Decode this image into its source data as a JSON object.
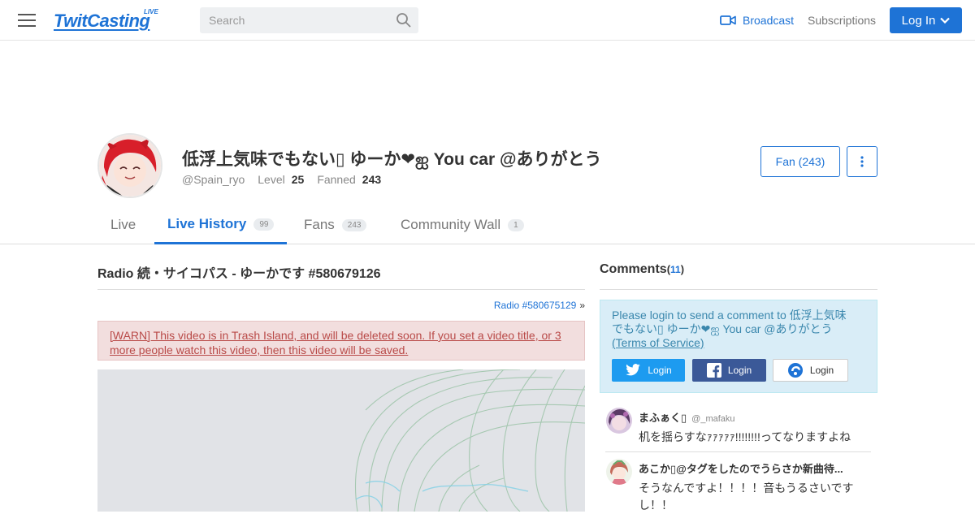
{
  "header": {
    "logo_text": "TwitCasting",
    "logo_live": "LIVE",
    "search_placeholder": "Search",
    "broadcast_label": "Broadcast",
    "subscriptions_label": "Subscriptions",
    "login_label": "Log In"
  },
  "profile": {
    "name": "低浮上気味でもない▯ ゆーか❤ஐ You car @ありがとう",
    "handle": "@Spain_ryo",
    "level_label": "Level",
    "level_value": "25",
    "fanned_label": "Fanned",
    "fanned_value": "243",
    "fan_button": "Fan (243)"
  },
  "tabs": [
    {
      "label": "Live",
      "badge": ""
    },
    {
      "label": "Live History",
      "badge": "99"
    },
    {
      "label": "Fans",
      "badge": "243"
    },
    {
      "label": "Community Wall",
      "badge": "1"
    }
  ],
  "main": {
    "title": "Radio 続・サイコパス - ゆーかです #580679126",
    "prev_link": "Radio #580675129",
    "prev_arrow": "»",
    "warning": "[WARN] This video is in Trash Island, and will be deleted soon. If you set a video title, or 3 more people watch this video, then this video will be saved."
  },
  "sidebar": {
    "title": "Comments",
    "count": "11",
    "login_message": "Please login to send a comment to 低浮上気味でもない▯ ゆーか❤ஐ You car @ありがとう",
    "tos_link": "(Terms of Service)",
    "login_buttons": [
      "Login",
      "Login",
      "Login"
    ],
    "comments": [
      {
        "name": "まふぁく▯",
        "handle": "@_mafaku",
        "text": "机を揺らすなｧｧｧｧｧ!!!!!!!!ってなりますよね"
      },
      {
        "name": "あこか▯@タグをしたのでうらさか新曲待...",
        "handle": "",
        "text": "そうなんですよ！！！！音もうるさいですし！！"
      }
    ]
  },
  "colors": {
    "accent": "#1e73d6",
    "warn_bg": "#f2dede",
    "info_bg": "#d9edf7"
  }
}
